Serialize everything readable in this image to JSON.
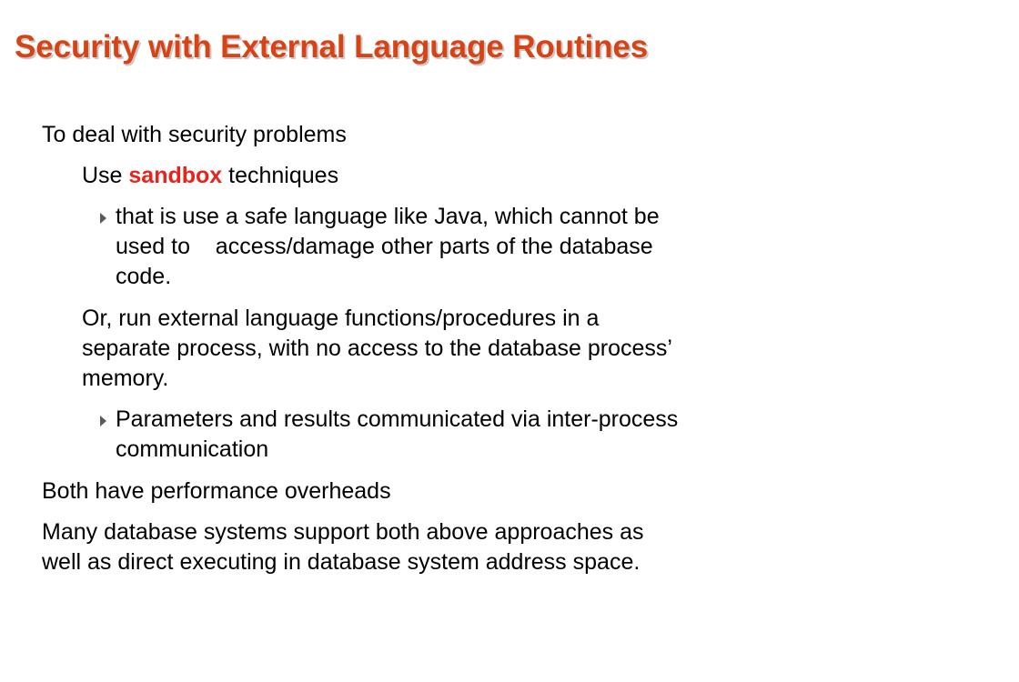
{
  "slide": {
    "title": "Security with External Language Routines",
    "colors": {
      "title": "#d84315",
      "highlight": "#e8231c",
      "text": "#000000",
      "bullet_arrow": "#5a5a5a"
    },
    "icons": {
      "bullet": "right-triangle-bullet-icon"
    },
    "items": {
      "deal": "To deal with security problems",
      "use_before": "Use ",
      "use_highlight": "sandbox",
      "use_after": " techniques",
      "java_line1": "that is use a safe language like Java, which cannot be",
      "java_line2": "used to    access/damage other parts of the database",
      "java_line3": "code.",
      "or_line1": "Or, run external language functions/procedures in a",
      "or_line2": "separate process, with no access to the database process’",
      "or_line3": "memory.",
      "params_line1": "Parameters and results communicated via inter-process",
      "params_line2": "communication",
      "both": "Both have performance overheads",
      "many_line1": "Many database systems support both above approaches as",
      "many_line2": "well as direct executing in database system address space."
    }
  }
}
